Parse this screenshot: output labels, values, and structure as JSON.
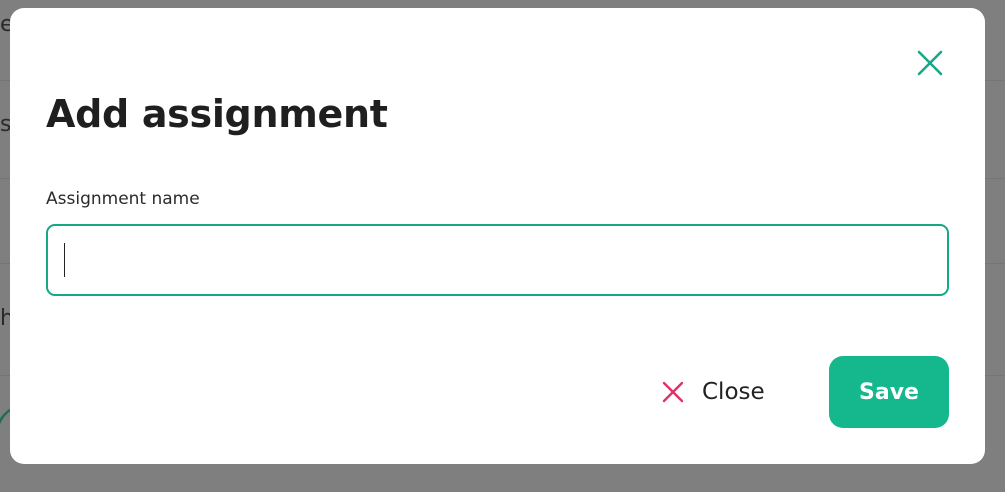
{
  "modal": {
    "title": "Add assignment",
    "field_label": "Assignment name",
    "input_value": "",
    "close_label": "Close",
    "save_label": "Save"
  },
  "backdrop": {
    "glyphs": [
      "e",
      "s",
      "h"
    ]
  },
  "colors": {
    "accent": "#15b78c",
    "input_border": "#14a885",
    "close_icon": "#e0306e",
    "dismiss_icon": "#17a886",
    "overlay": "#808080"
  },
  "icons": {
    "dismiss": "close-icon",
    "close_button": "close-icon"
  }
}
